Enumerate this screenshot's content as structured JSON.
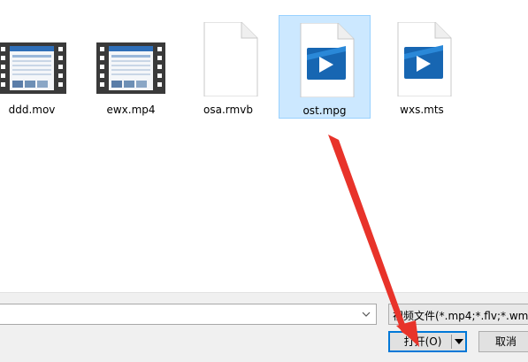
{
  "files": [
    {
      "name": "ddd.mov",
      "kind": "video-thumbnail"
    },
    {
      "name": "ewx.mp4",
      "kind": "video-thumbnail"
    },
    {
      "name": "osa.rmvb",
      "kind": "blank-document"
    },
    {
      "name": "ost.mpg",
      "kind": "media-file",
      "selected": true
    },
    {
      "name": "wxs.mts",
      "kind": "media-file"
    }
  ],
  "filename_input": {
    "value": ""
  },
  "file_type_filter": {
    "label": "视频文件(*.mp4;*.flv;*.wmv;*"
  },
  "buttons": {
    "open_label": "打开(O)",
    "cancel_label": "取消"
  },
  "colors": {
    "selection": "#cce8ff",
    "accent": "#0078d7",
    "annotation_arrow": "#e8332a"
  },
  "icons": [
    "film-strip-icon",
    "blank-file-icon",
    "media-play-file-icon",
    "chevron-down-icon",
    "dropdown-arrow-icon",
    "annotation-arrow"
  ]
}
